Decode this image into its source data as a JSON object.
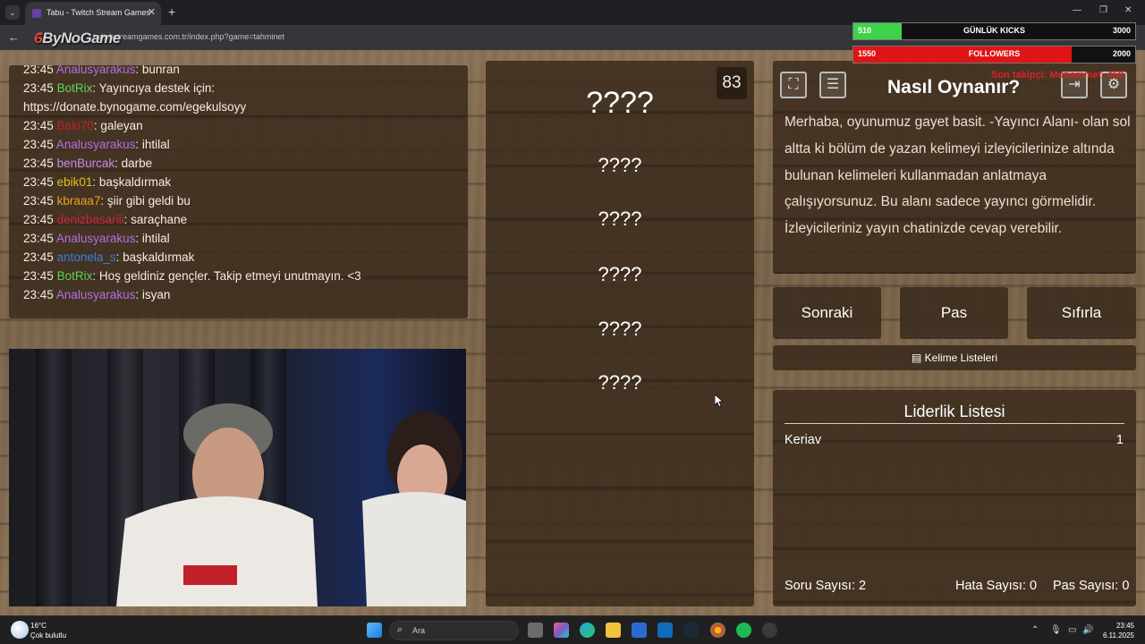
{
  "browser": {
    "tab_title": "Tabu - Twitch Stream Games",
    "url": "twitchstreamgames.com.tr/index.php?game=tahminet",
    "logo_text": "ByNoGame"
  },
  "overlay": {
    "kicks": {
      "label": "GÜNLÜK KICKS",
      "current": "510",
      "goal": "3000",
      "progress": 0.17,
      "color": "#3fd24a"
    },
    "followers": {
      "label": "FOLLOWERS",
      "current": "1550",
      "goal": "2000",
      "progress": 0.775,
      "color": "#e01414"
    },
    "red_text": "Son takipçi: Muhammet_458"
  },
  "chat": {
    "messages": [
      {
        "time": "23:45",
        "user": "Analusyarakus",
        "color": "#b46ee0",
        "text": ": bunran"
      },
      {
        "time": "23:45",
        "user": "BotRix",
        "color": "#5bd45b",
        "text": ": Yayıncıya destek için:"
      },
      {
        "time": "",
        "user": "",
        "color": "#ffffff",
        "text": "https://donate.bynogame.com/egekulsoyy"
      },
      {
        "time": "23:45",
        "user": "Baki70",
        "color": "#c0202a",
        "text": ": galeyan"
      },
      {
        "time": "23:45",
        "user": "Analusyarakus",
        "color": "#b46ee0",
        "text": ": ihtilal"
      },
      {
        "time": "23:45",
        "user": "benBurcak",
        "color": "#c08cf0",
        "text": ": darbe"
      },
      {
        "time": "23:45",
        "user": "ebik01",
        "color": "#e0c020",
        "text": ": başkaldırmak"
      },
      {
        "time": "23:45",
        "user": "kbraaa7",
        "color": "#f0a020",
        "text": ": şiir gibi geldi bu"
      },
      {
        "time": "23:45",
        "user": "denizbasarili",
        "color": "#d0263a",
        "text": ": saraçhane"
      },
      {
        "time": "23:45",
        "user": "Analusyarakus",
        "color": "#b46ee0",
        "text": ": ihtilal"
      },
      {
        "time": "23:45",
        "user": "antonela_s",
        "color": "#3d7be0",
        "text": ": başkaldırmak"
      },
      {
        "time": "23:45",
        "user": "BotRix",
        "color": "#5bd45b",
        "text": ": Hoş geldiniz gençler. Takip etmeyi unutmayın. <3"
      },
      {
        "time": "23:45",
        "user": "Analusyarakus",
        "color": "#b46ee0",
        "text": ": isyan"
      }
    ]
  },
  "words": {
    "main": "????",
    "hidden": [
      "????",
      "????",
      "????",
      "????",
      "????"
    ],
    "timer": "83"
  },
  "howto": {
    "title": "Nasıl Oynanır?",
    "text": "Merhaba, oyunumuz gayet basit. -Yayıncı Alanı- olan sol altta ki bölüm de yazan kelimeyi izleyicilerinize altında bulunan kelimeleri kullanmadan anlatmaya çalışıyorsunuz. Bu alanı sadece yayıncı görmelidir. İzleyicileriniz yayın chatinizde cevap verebilir."
  },
  "actions": {
    "next": "Sonraki",
    "pass": "Pas",
    "reset": "Sıfırla",
    "word_lists": "Kelime Listeleri"
  },
  "leaderboard": {
    "title": "Liderlik Listesi",
    "entries": [
      {
        "name": "Keriav",
        "score": "1"
      }
    ]
  },
  "stats": {
    "questions": "Soru Sayısı: 2",
    "errors": "Hata Sayısı: 0",
    "passes": "Pas Sayısı: 0"
  },
  "taskbar": {
    "temp": "16°C",
    "weather": "Çok bulutlu",
    "search_placeholder": "Ara",
    "time": "23:45",
    "date": "6.11.2025"
  }
}
